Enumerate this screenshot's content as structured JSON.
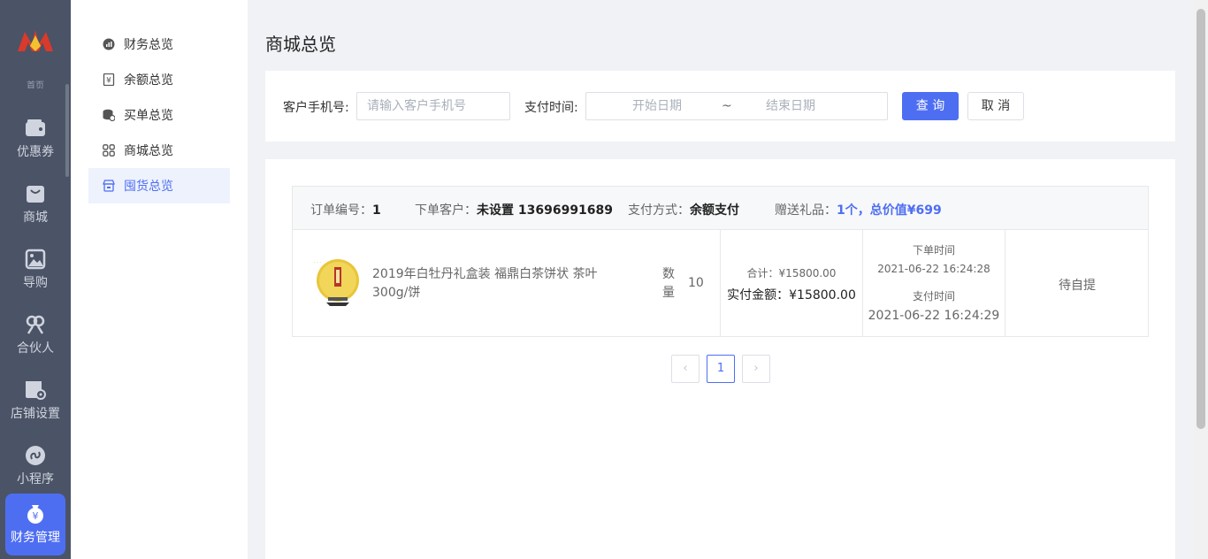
{
  "rail": {
    "logo_tail": "首页",
    "items": [
      {
        "label": "优惠券",
        "icon": "wallet-icon"
      },
      {
        "label": "商城",
        "icon": "bag-icon"
      },
      {
        "label": "导购",
        "icon": "image-icon"
      },
      {
        "label": "合伙人",
        "icon": "partner-icon"
      },
      {
        "label": "店铺设置",
        "icon": "store-settings-icon"
      },
      {
        "label": "小程序",
        "icon": "mini-program-icon"
      },
      {
        "label": "财务管理",
        "icon": "finance-icon"
      }
    ]
  },
  "subnav": {
    "items": [
      {
        "label": "财务总览",
        "icon": "chart-circle-icon"
      },
      {
        "label": "余额总览",
        "icon": "yuan-doc-icon"
      },
      {
        "label": "买单总览",
        "icon": "coins-icon"
      },
      {
        "label": "商城总览",
        "icon": "grid-icon"
      },
      {
        "label": "囤货总览",
        "icon": "store-icon"
      }
    ]
  },
  "page": {
    "title": "商城总览"
  },
  "filter": {
    "phone_label": "客户手机号:",
    "phone_placeholder": "请输入客户手机号",
    "time_label": "支付时间:",
    "start_placeholder": "开始日期",
    "separator": "~",
    "end_placeholder": "结束日期",
    "query_button": "查 询",
    "cancel_button": "取 消"
  },
  "order": {
    "order_no_label": "订单编号：",
    "order_no": "1",
    "customer_label": "下单客户：",
    "customer": "未设置 13696991689",
    "pay_method_label": "支付方式：",
    "pay_method": "余额支付",
    "gift_label": "赠送礼品：",
    "gift": "1个，总价值¥699",
    "product_name": "2019年白牡丹礼盒装 福鼎白茶饼状 茶叶300g/饼",
    "qty_label": "数量",
    "qty": "10",
    "subtotal": "合计：¥15800.00",
    "paid_label": "实付金额：",
    "paid": "¥15800.00",
    "order_time_label": "下单时间",
    "order_time": "2021-06-22 16:24:28",
    "pay_time_label": "支付时间",
    "pay_time": "2021-06-22 16:24:29",
    "status": "待自提"
  },
  "pagination": {
    "prev": "‹",
    "current": "1",
    "next": "›"
  },
  "colors": {
    "accent": "#4e6ef2",
    "rail_bg": "#4b5366"
  }
}
